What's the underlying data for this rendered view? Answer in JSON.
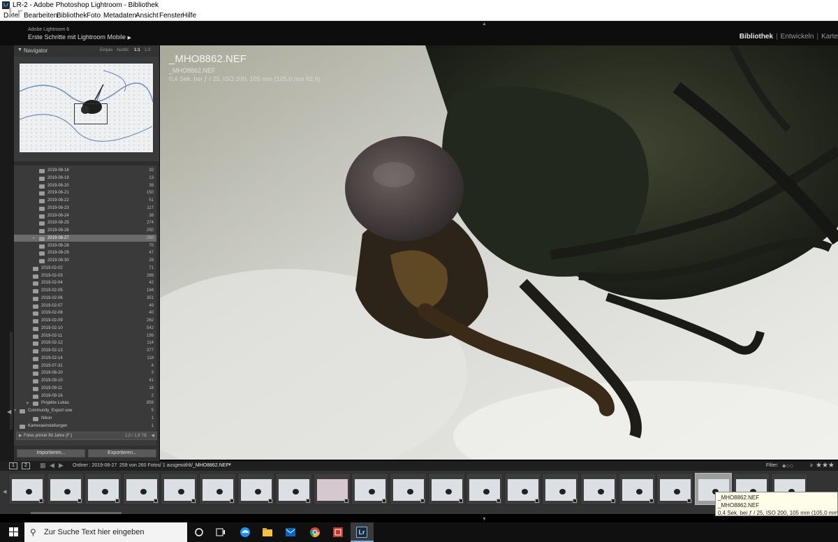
{
  "window": {
    "title": "LR-2 - Adobe Photoshop Lightroom - Bibliothek"
  },
  "menu": [
    "Datei",
    "Bearbeiten",
    "Bibliothek",
    "Foto",
    "Metadaten",
    "Ansicht",
    "Fenster",
    "Hilfe"
  ],
  "header": {
    "logo": "Lr",
    "product": "Adobe Lightroom 6",
    "identity_plate": "Erste Schritte mit Lightroom Mobile",
    "modules": [
      "Bibliothek",
      "Entwickeln",
      "Karte"
    ],
    "active_module": "Bibliothek"
  },
  "navigator": {
    "title": "Navigator",
    "zoom_options": [
      "Einpas",
      "Ausfül",
      "1:1",
      "1:3"
    ]
  },
  "folders": [
    {
      "name": "2019-08-18",
      "count": "32",
      "level": 2
    },
    {
      "name": "2019-08-19",
      "count": "13",
      "level": 2
    },
    {
      "name": "2019-08-20",
      "count": "39",
      "level": 2
    },
    {
      "name": "2019-08-21",
      "count": "150",
      "level": 2
    },
    {
      "name": "2019-08-22",
      "count": "51",
      "level": 2
    },
    {
      "name": "2019-08-23",
      "count": "117",
      "level": 2
    },
    {
      "name": "2019-08-24",
      "count": "38",
      "level": 2
    },
    {
      "name": "2019-08-25",
      "count": "274",
      "level": 2
    },
    {
      "name": "2019-08-26",
      "count": "250",
      "level": 2
    },
    {
      "name": "2019-08-27",
      "count": "260",
      "level": 2,
      "selected": true
    },
    {
      "name": "2019-08-28",
      "count": "70",
      "level": 2
    },
    {
      "name": "2019-08-29",
      "count": "47",
      "level": 2
    },
    {
      "name": "2019-08-30",
      "count": "28",
      "level": 2
    },
    {
      "name": "2019-02-02",
      "count": "71",
      "level": 1
    },
    {
      "name": "2019-02-03",
      "count": "289",
      "level": 1
    },
    {
      "name": "2019-02-04",
      "count": "42",
      "level": 1
    },
    {
      "name": "2019-02-05",
      "count": "194",
      "level": 1
    },
    {
      "name": "2019-02-06",
      "count": "351",
      "level": 1
    },
    {
      "name": "2019-02-07",
      "count": "49",
      "level": 1
    },
    {
      "name": "2019-02-08",
      "count": "40",
      "level": 1
    },
    {
      "name": "2019-02-09",
      "count": "262",
      "level": 1
    },
    {
      "name": "2019-02-10",
      "count": "542",
      "level": 1
    },
    {
      "name": "2019-02-11",
      "count": "199",
      "level": 1
    },
    {
      "name": "2019-02-12",
      "count": "114",
      "level": 1
    },
    {
      "name": "2019-02-13",
      "count": "377",
      "level": 1
    },
    {
      "name": "2019-02-14",
      "count": "118",
      "level": 1
    },
    {
      "name": "2019-07-31",
      "count": "4",
      "level": 1
    },
    {
      "name": "2019-08-20",
      "count": "3",
      "level": 1
    },
    {
      "name": "2019-09-10",
      "count": "41",
      "level": 1
    },
    {
      "name": "2019-09-11",
      "count": "18",
      "level": 1
    },
    {
      "name": "2019-09-16",
      "count": "2",
      "level": 1
    },
    {
      "name": "Projekte Lukas",
      "count": "859",
      "level": 1,
      "collapsed": true
    },
    {
      "name": "Community_Export usw",
      "count": "5",
      "level": 0,
      "expanded": true
    },
    {
      "name": "Nikon",
      "count": "1",
      "level": 1
    },
    {
      "name": "Kameraeinstellungen",
      "count": "1",
      "level": 0
    }
  ],
  "volume": {
    "label": "Fotos primär lfd Jahre (F:)",
    "size": "1,0 / 1,8 TB"
  },
  "buttons": {
    "import": "Importieren...",
    "export": "Exportieren..."
  },
  "photo": {
    "filename": "_MHO8862.NEF",
    "filename_sub": "_MHO8862.NEF",
    "exif": "0,4 Sek. bei ƒ / 25, ISO 200, 105 mm (105,0 mm f/2,8)"
  },
  "filmstrip": {
    "screen1": "1",
    "screen2": "2",
    "folder_label": "Ordner : 2019-08-27",
    "count_text": "259 von 260 Fotos/ 1 ausgewählt/",
    "current_file": "_MHO8862.NEF",
    "filter_label": "Filter:",
    "filter_op": "≥",
    "stars": "★★★",
    "thumb_count": 21,
    "selected_index": 18,
    "pink_index": 8
  },
  "tooltip": {
    "line1": "_MHO8862.NEF",
    "line2": "_MHO8862.NEF",
    "line3": "0,4 Sek. bei ƒ / 25, ISO 200, 105 mm (105,0 mm f/2,8)"
  },
  "taskbar": {
    "search_placeholder": "Zur Suche Text hier eingeben"
  }
}
